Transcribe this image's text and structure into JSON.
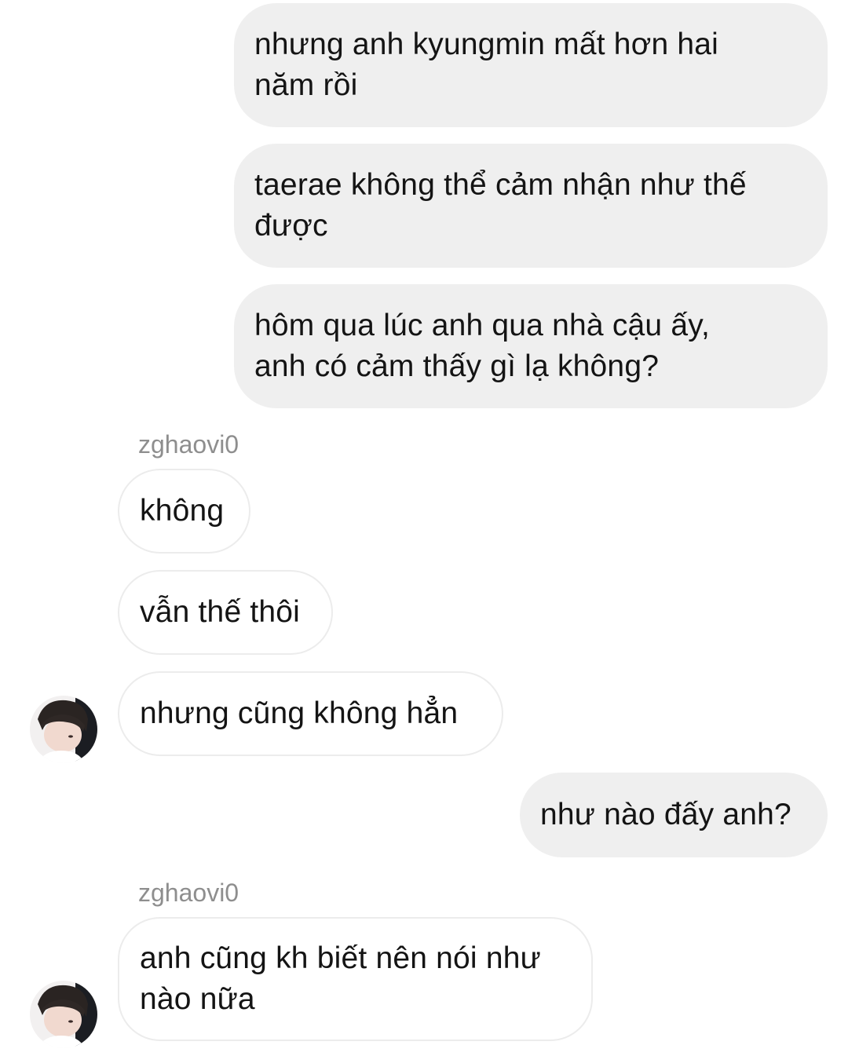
{
  "messages": {
    "m1": "nhưng anh kyungmin mất hơn hai\nnăm rồi",
    "m2": "taerae không thể cảm nhận như thế\nđược",
    "m3": "hôm qua lúc anh qua nhà cậu ấy,\nanh có cảm thấy gì lạ không?",
    "m4": "không",
    "m5": "vẫn thế thôi",
    "m6": "nhưng cũng không hẳn",
    "m7": "như nào đấy anh?",
    "m8": "anh cũng kh biết nên nói như\nnào nữa"
  },
  "senders": {
    "s1": "zghaovi0",
    "s2": "zghaovi0"
  },
  "avatar": {
    "icon": "user-photo-avatar"
  },
  "colors": {
    "outgoing_bubble": "#efefef",
    "incoming_border": "#ececec",
    "sender_text": "#8e8e8e"
  }
}
